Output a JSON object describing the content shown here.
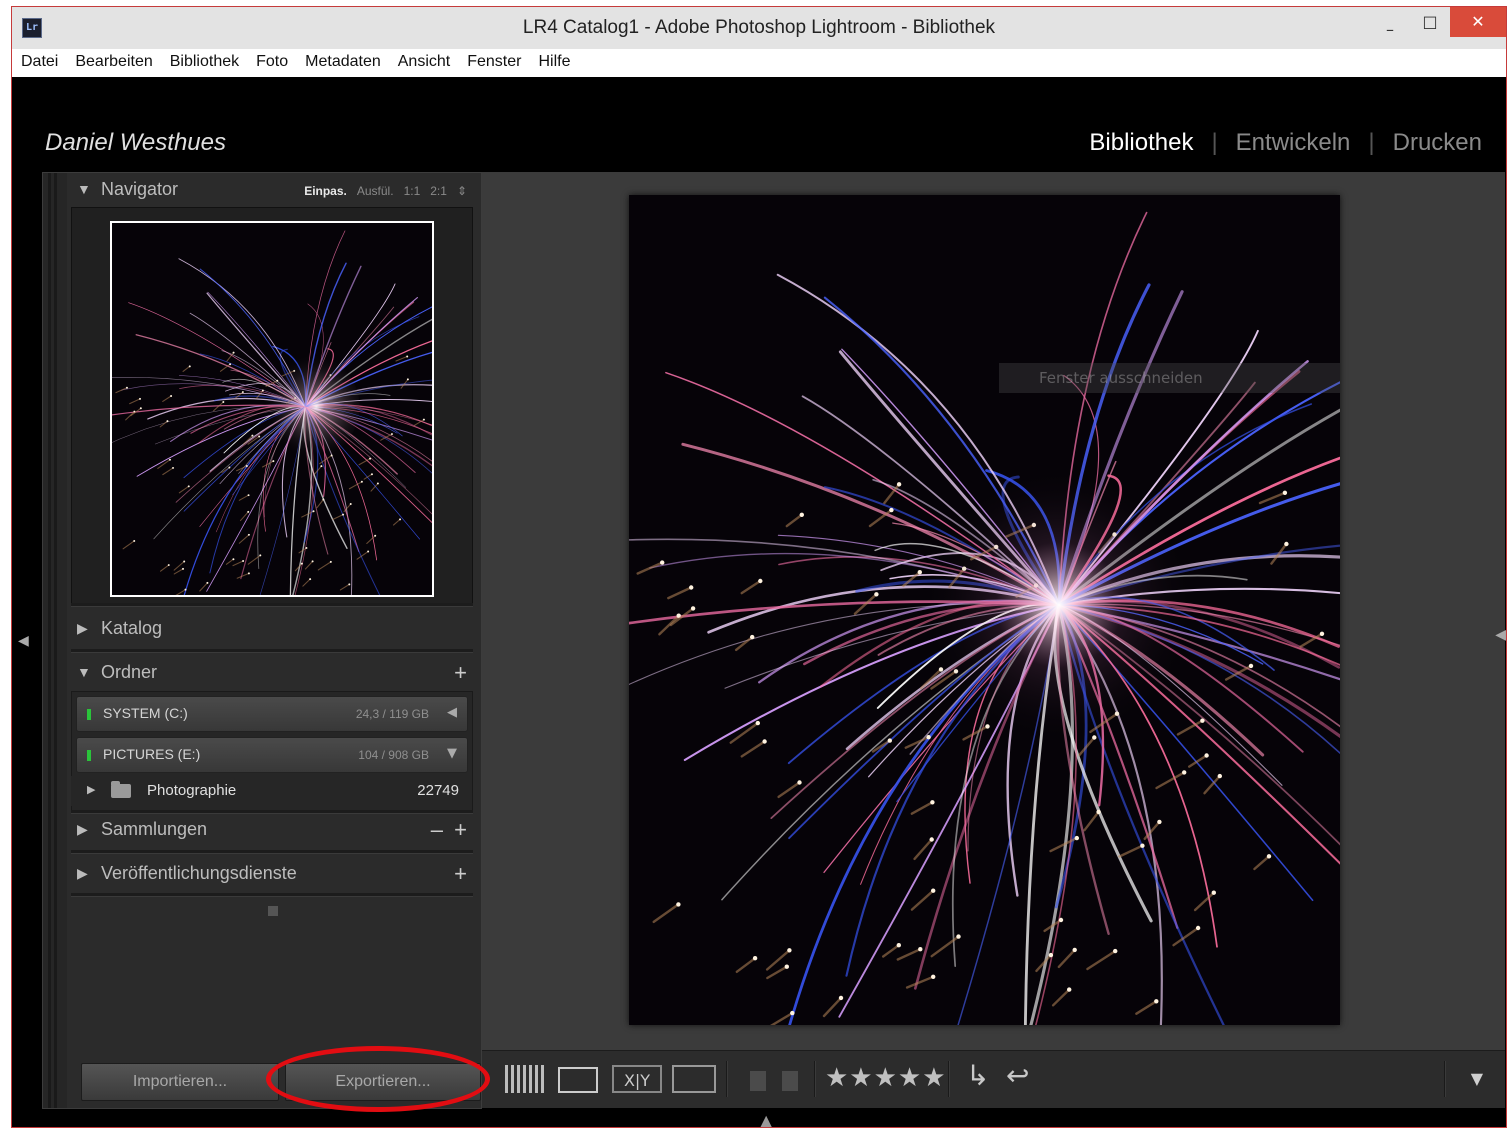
{
  "window": {
    "title": "LR4 Catalog1 - Adobe Photoshop Lightroom - Bibliothek",
    "app_icon_text": "Lr",
    "controls": {
      "minimize": "–",
      "maximize": "□",
      "close": "✕"
    }
  },
  "menubar": [
    "Datei",
    "Bearbeiten",
    "Bibliothek",
    "Foto",
    "Metadaten",
    "Ansicht",
    "Fenster",
    "Hilfe"
  ],
  "identity_plate": "Daniel Westhues",
  "modules": {
    "active": "Bibliothek",
    "items": [
      "Bibliothek",
      "Entwickeln",
      "Drucken"
    ]
  },
  "navigator": {
    "label": "Navigator",
    "zoom_options": [
      "Einpas.",
      "Ausfül.",
      "1:1",
      "2:1"
    ],
    "zoom_selected": "Einpas.",
    "zoom_dropdown": "⇕"
  },
  "panels": {
    "katalog": "Katalog",
    "ordner": "Ordner",
    "sammlungen": "Sammlungen",
    "veroeffentlichung": "Veröffentlichungsdienste",
    "add": "+",
    "remove": "–"
  },
  "volumes": [
    {
      "name": "SYSTEM (C:)",
      "size": "24,3 / 119 GB",
      "indicator": "◀"
    },
    {
      "name": "PICTURES (E:)",
      "size": "104 / 908 GB",
      "indicator": "▼"
    }
  ],
  "folders": [
    {
      "name": "Photographie",
      "count": "22749"
    }
  ],
  "buttons": {
    "import": "Importieren...",
    "export": "Exportieren..."
  },
  "overlay_hint": "Fenster ausschneiden",
  "toolbar": {
    "xy_label": "X|Y",
    "stars": "★★★★★",
    "rotate_left": "↳",
    "rotate_right": "↩",
    "dropdown": "▼"
  },
  "colors": {
    "highlight_circle": "#e20d12",
    "close_button": "#d94b3a",
    "volume_led": "#2ac43a"
  }
}
